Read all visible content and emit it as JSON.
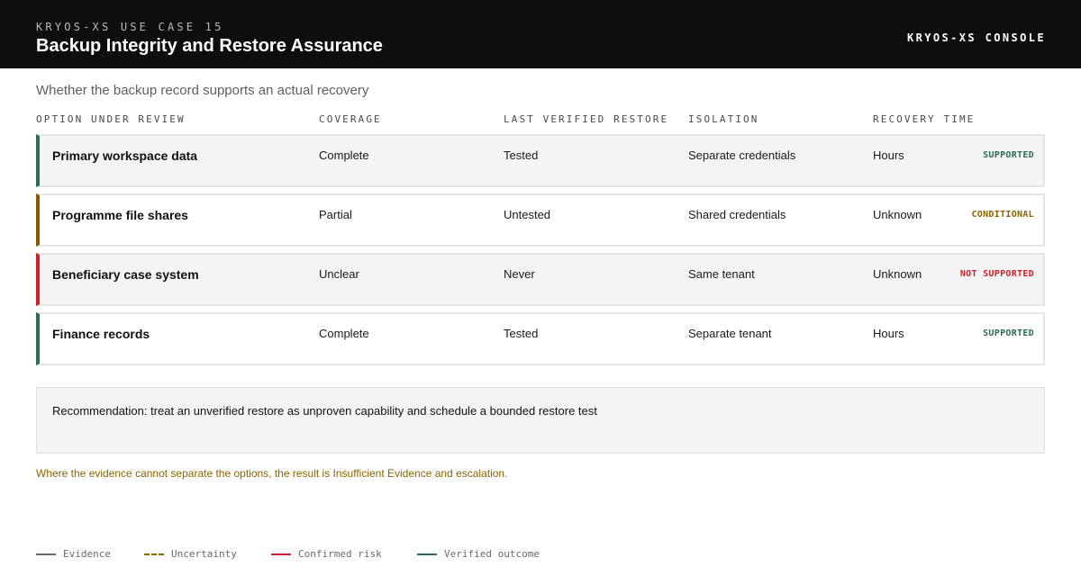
{
  "header": {
    "eyebrow": "KRYOS-XS USE CASE 15",
    "title": "Backup Integrity and Restore Assurance",
    "console_label": "KRYOS-XS CONSOLE"
  },
  "subtitle": "Whether the backup record supports an actual recovery",
  "table": {
    "columns": [
      "OPTION UNDER REVIEW",
      "COVERAGE",
      "LAST VERIFIED RESTORE",
      "ISOLATION",
      "RECOVERY TIME"
    ],
    "rows": [
      {
        "option": "Primary workspace data",
        "coverage": "Complete",
        "last_verified_restore": "Tested",
        "isolation": "Separate credentials",
        "recovery_time": "Hours",
        "status": "SUPPORTED",
        "accent": "#2e6b4f",
        "status_color": "#2e6b4f",
        "background": "#f4f4f4"
      },
      {
        "option": "Programme file shares",
        "coverage": "Partial",
        "last_verified_restore": "Untested",
        "isolation": "Shared credentials",
        "recovery_time": "Unknown",
        "status": "CONDITIONAL",
        "accent": "#8a5a00",
        "status_color": "#8a6400",
        "background": "#ffffff"
      },
      {
        "option": "Beneficiary case system",
        "coverage": "Unclear",
        "last_verified_restore": "Never",
        "isolation": "Same tenant",
        "recovery_time": "Unknown",
        "status": "NOT SUPPORTED",
        "accent": "#c8232b",
        "status_color": "#c8232b",
        "background": "#f4f4f4"
      },
      {
        "option": "Finance records",
        "coverage": "Complete",
        "last_verified_restore": "Tested",
        "isolation": "Separate tenant",
        "recovery_time": "Hours",
        "status": "SUPPORTED",
        "accent": "#2e6b4f",
        "status_color": "#2e6b4f",
        "background": "#ffffff"
      }
    ]
  },
  "recommendation": "Recommendation: treat an unverified restore as unproven capability and schedule a bounded restore test",
  "note": "Where the evidence cannot separate the options, the result is Insufficient Evidence and escalation.",
  "legend": [
    {
      "label": "Evidence",
      "color": "#6a6a6a",
      "style": "solid"
    },
    {
      "label": "Uncertainty",
      "color": "#8a6400",
      "style": "dashed"
    },
    {
      "label": "Confirmed risk",
      "color": "#c8232b",
      "style": "solid"
    },
    {
      "label": "Verified outcome",
      "color": "#2e6b4f",
      "style": "solid"
    }
  ]
}
